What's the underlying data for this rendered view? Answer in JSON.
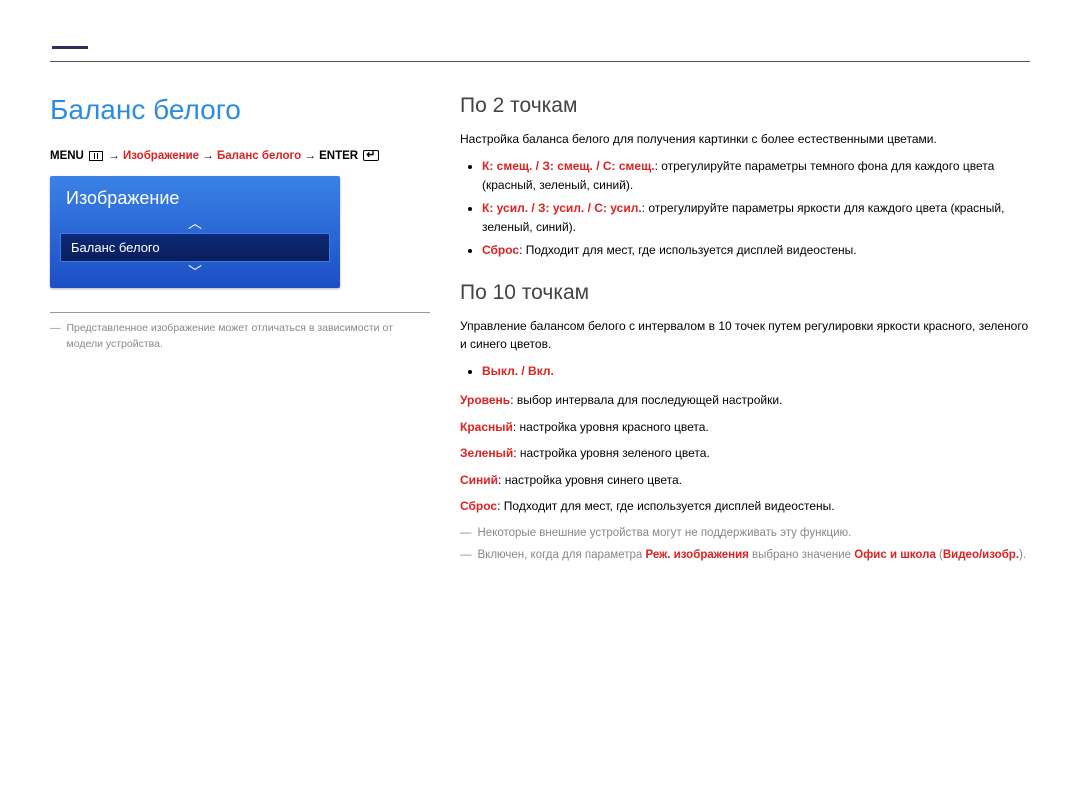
{
  "header": {},
  "left": {
    "title": "Баланс белого",
    "menu_path": {
      "menu": "MENU",
      "arrow": "→",
      "seg1": "Изображение",
      "seg2": "Баланс белого",
      "enter": "ENTER"
    },
    "osd": {
      "title": "Изображение",
      "arrow_up": "︿",
      "arrow_down": "﹀",
      "selected": "Баланс белого"
    },
    "footnote": "Представленное изображение может отличаться в зависимости от модели устройства."
  },
  "right": {
    "s1": {
      "heading": "По 2 точкам",
      "intro": "Настройка баланса белого для получения картинки с более естественными цветами.",
      "b1_label": "К: смещ. / З: смещ. / С: смещ.",
      "b1_text": ": отрегулируйте параметры темного фона для каждого цвета (красный, зеленый, синий).",
      "b2_label": "К: усил. / З: усил. / С: усил.",
      "b2_text": ": отрегулируйте параметры яркости для каждого цвета (красный, зеленый, синий).",
      "b3_label": "Сброс",
      "b3_text": ": Подходит для мест, где используется дисплей видеостены."
    },
    "s2": {
      "heading": "По 10 точкам",
      "intro": "Управление балансом белого с интервалом в 10 точек путем регулировки яркости красного, зеленого и синего цветов.",
      "b1": "Выкл. / Вкл.",
      "l1_label": "Уровень",
      "l1_text": ": выбор интервала для последующей настройки.",
      "l2_label": "Красный",
      "l2_text": ": настройка уровня красного цвета.",
      "l3_label": "Зеленый",
      "l3_text": ": настройка уровня зеленого цвета.",
      "l4_label": "Синий",
      "l4_text": ": настройка уровня синего цвета.",
      "l5_label": "Сброс",
      "l5_text": ": Подходит для мест, где используется дисплей видеостены.",
      "note1": "Некоторые внешние устройства могут не поддерживать эту функцию.",
      "note2_a": "Включен, когда для параметра ",
      "note2_b": "Реж. изображения",
      "note2_c": " выбрано значение ",
      "note2_d": "Офис и школа",
      "note2_e": " (",
      "note2_f": "Видео/изобр.",
      "note2_g": ")."
    }
  }
}
